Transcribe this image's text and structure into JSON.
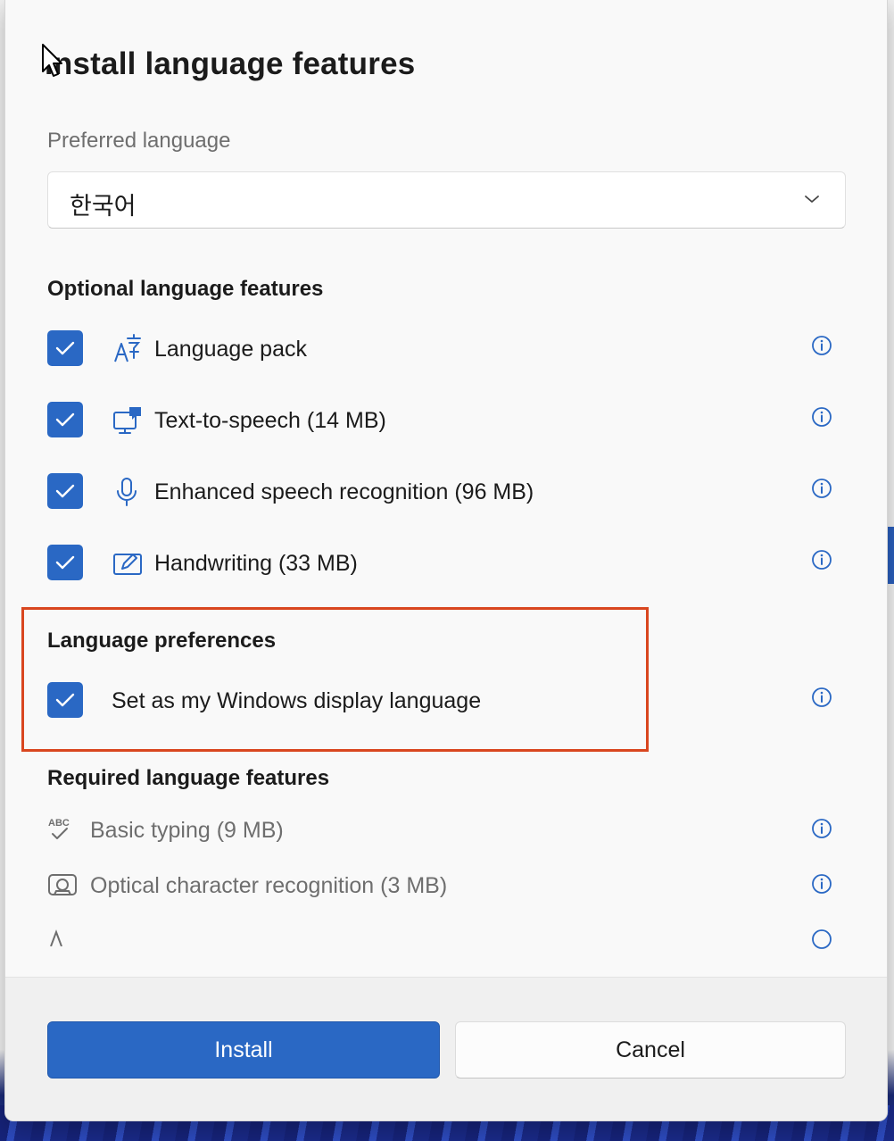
{
  "dialog": {
    "title": "Install language features",
    "preferred_language": {
      "label": "Preferred language",
      "selected": "한국어"
    },
    "optional_section": {
      "title": "Optional language features",
      "items": [
        {
          "label": "Language pack",
          "checked": true,
          "icon": "language-pack-icon"
        },
        {
          "label": "Text-to-speech (14 MB)",
          "checked": true,
          "icon": "text-to-speech-icon"
        },
        {
          "label": "Enhanced speech recognition (96 MB)",
          "checked": true,
          "icon": "microphone-icon"
        },
        {
          "label": "Handwriting (33 MB)",
          "checked": true,
          "icon": "handwriting-icon"
        }
      ]
    },
    "preferences_section": {
      "title": "Language preferences",
      "items": [
        {
          "label": "Set as my Windows display language",
          "checked": true
        }
      ]
    },
    "required_section": {
      "title": "Required language features",
      "items": [
        {
          "label": "Basic typing (9 MB)",
          "icon": "basic-typing-icon"
        },
        {
          "label": "Optical character recognition (3 MB)",
          "icon": "ocr-icon"
        }
      ]
    },
    "buttons": {
      "install": "Install",
      "cancel": "Cancel"
    }
  },
  "colors": {
    "accent": "#2a68c4",
    "highlight_border": "#d9461f",
    "info_icon": "#2a68c4"
  }
}
